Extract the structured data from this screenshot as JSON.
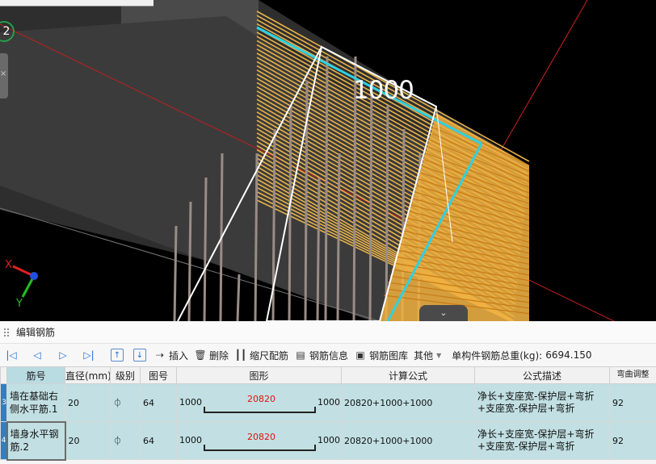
{
  "viewport": {
    "dimension_label": "1000",
    "view_number": "2",
    "axis_x": "X",
    "axis_y": "Y",
    "left_tab_glyph": "×",
    "collapse_glyph": "⌄"
  },
  "panel": {
    "title": "编辑钢筋"
  },
  "toolbar": {
    "first_glyph": "|◁",
    "prev_glyph": "◁",
    "next_glyph": "▷",
    "last_glyph": "▷|",
    "up_glyph": "↑",
    "down_glyph": "↓",
    "insert": "插入",
    "delete": "删除",
    "scale_rebar": "缩尺配筋",
    "rebar_info": "钢筋信息",
    "rebar_library": "钢筋图库",
    "other": "其他",
    "total_weight_label": "单构件钢筋总重(kg):",
    "total_weight_value": "6694.150"
  },
  "table": {
    "headers": [
      "筋号",
      "直径(mm)",
      "级别",
      "图号",
      "图形",
      "计算公式",
      "公式描述",
      "弯曲调整"
    ],
    "rows": [
      {
        "index": "3",
        "name": "墙在基础右侧水平筋.1",
        "diameter": "20",
        "grade": "⏀",
        "figure_no": "64",
        "shape_left": "1000",
        "shape_middle": "20820",
        "shape_right": "1000",
        "formula": "20820+1000+1000",
        "description": "净长+支座宽-保护层+弯折+支座宽-保护层+弯折",
        "bend": "92"
      },
      {
        "index": "4",
        "name": "墙身水平钢筋.2",
        "diameter": "20",
        "grade": "⏀",
        "figure_no": "64",
        "shape_left": "1000",
        "shape_middle": "20820",
        "shape_right": "1000",
        "formula": "20820+1000+1000",
        "description": "净长+支座宽-保护层+弯折+支座宽-保护层+弯折",
        "bend": "92"
      }
    ]
  }
}
